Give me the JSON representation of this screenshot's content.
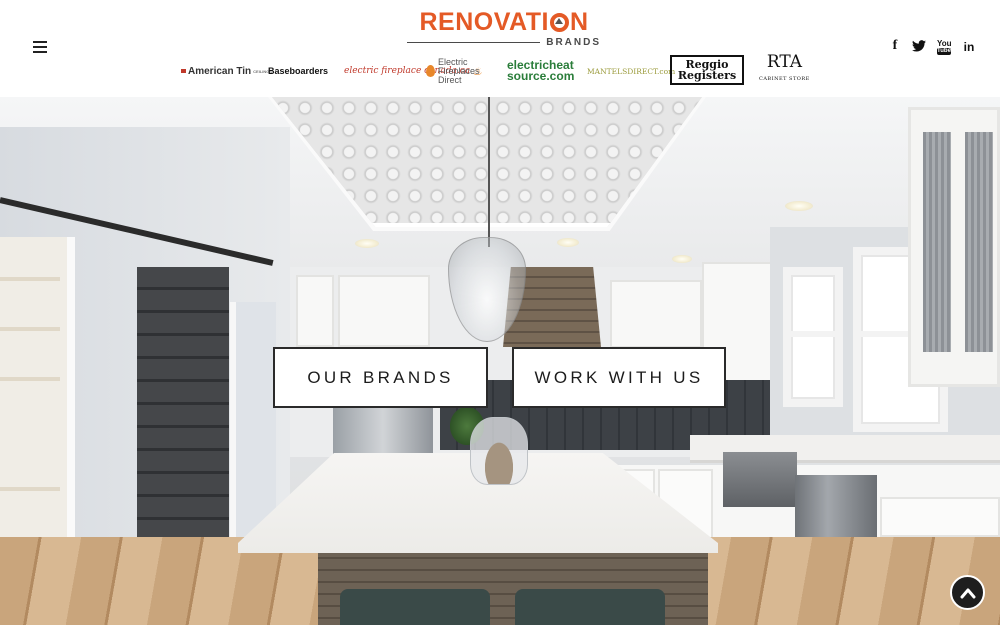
{
  "header": {
    "logo_main_left": "RENOVATI",
    "logo_main_right": "N",
    "logo_sub": "BRANDS",
    "menu_icon": "hamburger-menu-icon"
  },
  "brands": [
    {
      "name": "American Tin",
      "sub": "CEILINGS"
    },
    {
      "name": "Baseboarders"
    },
    {
      "name": "electric fireplace canada.ca"
    },
    {
      "name": "Electric Fireplaces Direct"
    },
    {
      "name": "electricheat source.com"
    },
    {
      "name": "MANTELSDIRECT.com"
    },
    {
      "name": "Reggio Registers"
    },
    {
      "name": "RTA",
      "sub": "CABINET STORE"
    }
  ],
  "social": {
    "facebook": "f",
    "twitter": "twitter-icon",
    "youtube_top": "You",
    "youtube_bottom": "Tube",
    "linkedin": "in"
  },
  "hero": {
    "cta_brands": "OUR BRANDS",
    "cta_work": "WORK WITH US"
  },
  "scroll_top_icon": "chevron-up-icon",
  "colors": {
    "brand_orange": "#e45a26",
    "dark": "#1e1e1e"
  }
}
